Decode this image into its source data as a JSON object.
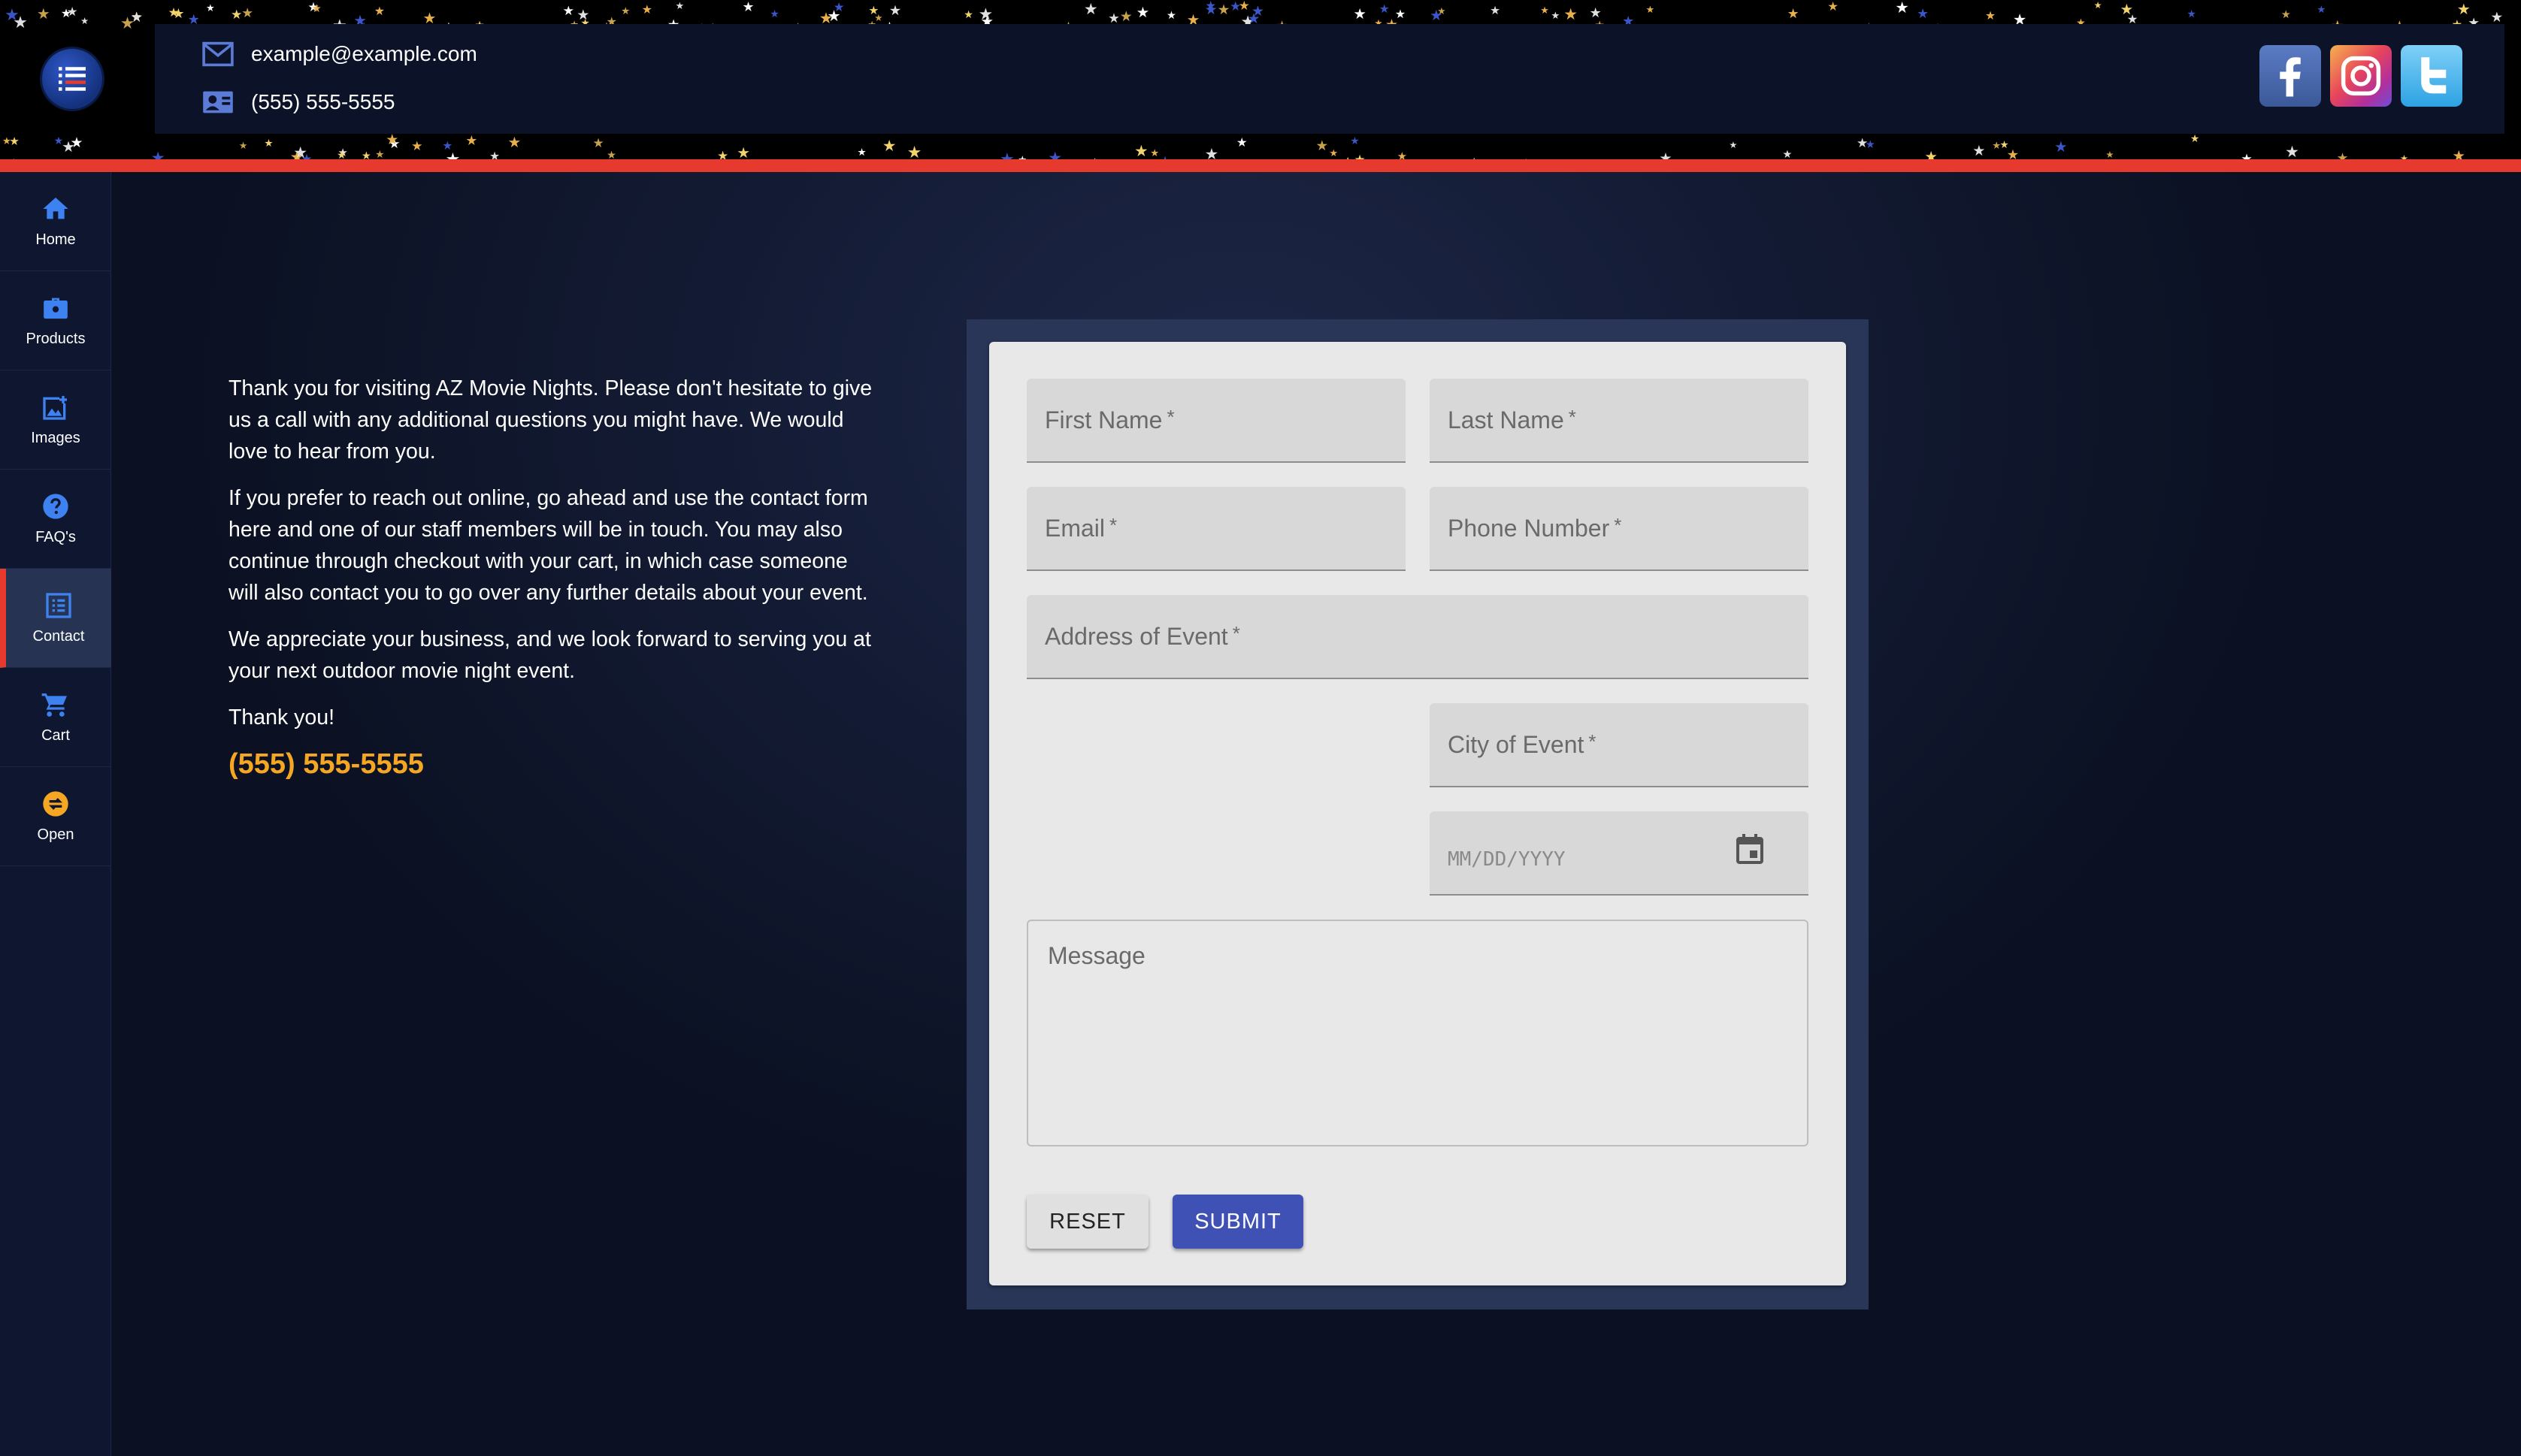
{
  "header": {
    "email": "example@example.com",
    "phone": "(555) 555-5555",
    "icons": {
      "logo": "list-logo-icon",
      "email": "envelope-icon",
      "phone": "contact-card-icon",
      "social": [
        "facebook-icon",
        "instagram-icon",
        "twitter-icon"
      ]
    },
    "colors": {
      "accent_stripe": "#e53a2d"
    }
  },
  "sidebar": {
    "items": [
      {
        "label": "Home",
        "icon": "home-icon"
      },
      {
        "label": "Products",
        "icon": "briefcase-icon"
      },
      {
        "label": "Images",
        "icon": "image-icon"
      },
      {
        "label": "FAQ's",
        "icon": "help-icon"
      },
      {
        "label": "Contact",
        "icon": "list-icon",
        "active": true
      },
      {
        "label": "Cart",
        "icon": "cart-icon"
      },
      {
        "label": "Open",
        "icon": "open-icon"
      }
    ]
  },
  "intro": {
    "p1": "Thank you for visiting AZ Movie Nights. Please don't hesitate to give us a call with any additional questions you might have. We would love to hear from you.",
    "p2": "If you prefer to reach out online, go ahead and use the contact form here and one of our staff members will be in touch. You may also continue through checkout with your cart, in which case someone will also contact you to go over any further details about your event.",
    "p3": "We appreciate your business, and we look forward to serving you at your next outdoor movie night event.",
    "p4": "Thank you!",
    "phone": "(555) 555-5555",
    "phone_color": "#f5a623"
  },
  "form": {
    "first_name": "First Name",
    "last_name": "Last Name",
    "email": "Email",
    "phone_number": "Phone Number",
    "address": "Address of Event",
    "city": "City of Event",
    "required_mark": "*",
    "date_placeholder": "MM/DD/YYYY",
    "message_placeholder": "Message",
    "reset_label": "RESET",
    "submit_label": "SUBMIT",
    "submit_color": "#3f51b5"
  }
}
